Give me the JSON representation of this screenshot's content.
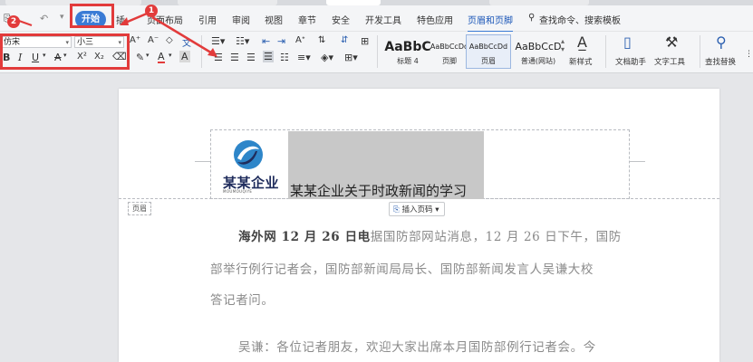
{
  "menu": {
    "start": "开始",
    "insert_partial": "插",
    "items": [
      "页面布局",
      "引用",
      "审阅",
      "视图",
      "章节",
      "安全",
      "开发工具",
      "特色应用",
      "页眉和页脚"
    ],
    "search": "查找命令、搜索模板"
  },
  "font": {
    "name": "仿宋",
    "size": "小三",
    "btn_bold": "B",
    "btn_italic": "I",
    "btn_underline": "U",
    "btn_strike": "A",
    "btn_super": "X²",
    "btn_sub": "X₂",
    "btn_grow": "A⁺",
    "btn_shrink": "A⁻",
    "btn_color": "A",
    "btn_shade": "A"
  },
  "styles": [
    {
      "sample": "AaBbC",
      "name": "标题 4"
    },
    {
      "sample": "AaBbCcDd",
      "name": "页脚"
    },
    {
      "sample": "AaBbCcDd",
      "name": "页眉"
    },
    {
      "sample": "AaBbCcD",
      "name": "普通(网站)"
    }
  ],
  "tools": {
    "new_style": "新样式",
    "doc_helper": "文档助手",
    "text_tools": "文字工具",
    "find_replace": "查找替换"
  },
  "annotations": {
    "badge1": "1",
    "badge2": "2"
  },
  "document": {
    "header_title": "某某企业关于时政新闻的学习",
    "logo_text": "某某企业",
    "logo_sub": "MOUMOUQIYE",
    "header_tag": "页眉",
    "insert_page_number": "插入页码",
    "p1_bold": "海外网 12 月 26 日电",
    "p1_rest": "据国防部网站消息，12 月 26 日下午，国防",
    "p2": "部举行例行记者会，国防部新闻局局长、国防部新闻发言人吴谦大校",
    "p3": "答记者问。",
    "p4": "吴谦：各位记者朋友，欢迎大家出席本月国防部例行记者会。今"
  }
}
